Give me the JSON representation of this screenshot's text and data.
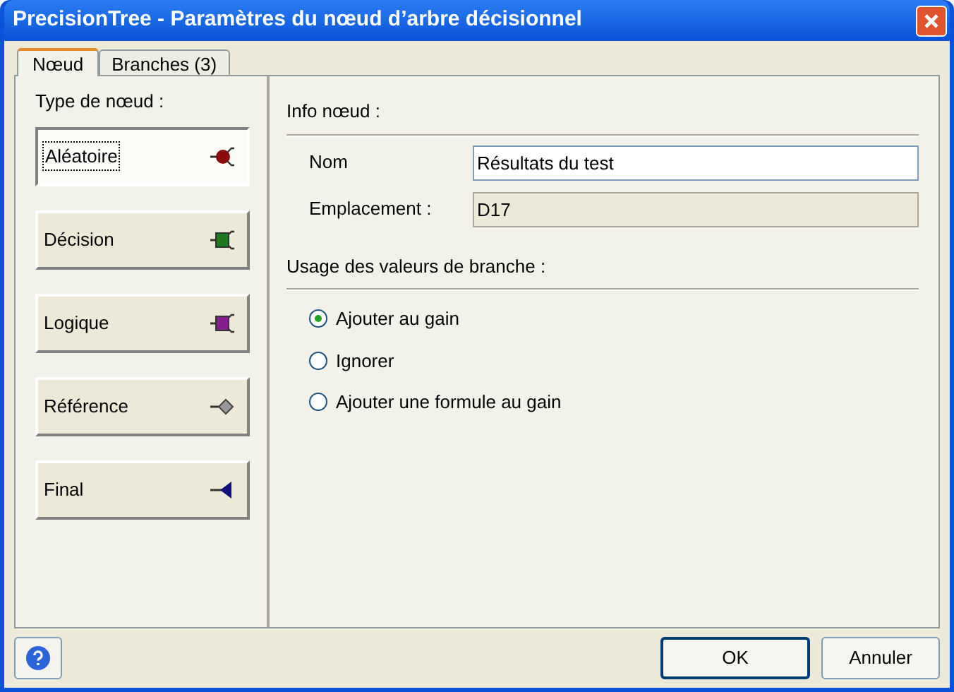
{
  "window": {
    "title": "PrecisionTree - Paramètres du nœud d’arbre décisionnel"
  },
  "tabs": [
    {
      "label": "Nœud",
      "selected": true
    },
    {
      "label": "Branches (3)",
      "selected": false
    }
  ],
  "node_type": {
    "label": "Type de nœud :",
    "items": [
      {
        "label": "Aléatoire",
        "kind": "chance",
        "selected": true
      },
      {
        "label": "Décision",
        "kind": "decision",
        "selected": false
      },
      {
        "label": "Logique",
        "kind": "logic",
        "selected": false
      },
      {
        "label": "Référence",
        "kind": "reference",
        "selected": false
      },
      {
        "label": "Final",
        "kind": "end",
        "selected": false
      }
    ]
  },
  "node_info": {
    "heading": "Info nœud :",
    "fields": [
      {
        "label": "Nom",
        "value": "Résultats du test",
        "disabled": false
      },
      {
        "label": "Emplacement :",
        "value": "D17",
        "disabled": true
      }
    ]
  },
  "branch_values": {
    "heading": "Usage des valeurs de branche :",
    "options": [
      {
        "label": "Ajouter au gain",
        "selected": true
      },
      {
        "label": "Ignorer",
        "selected": false
      },
      {
        "label": "Ajouter une formule au gain",
        "selected": false
      }
    ]
  },
  "buttons": [
    {
      "label": "OK",
      "default": true
    },
    {
      "label": "Annuler",
      "default": false
    }
  ]
}
